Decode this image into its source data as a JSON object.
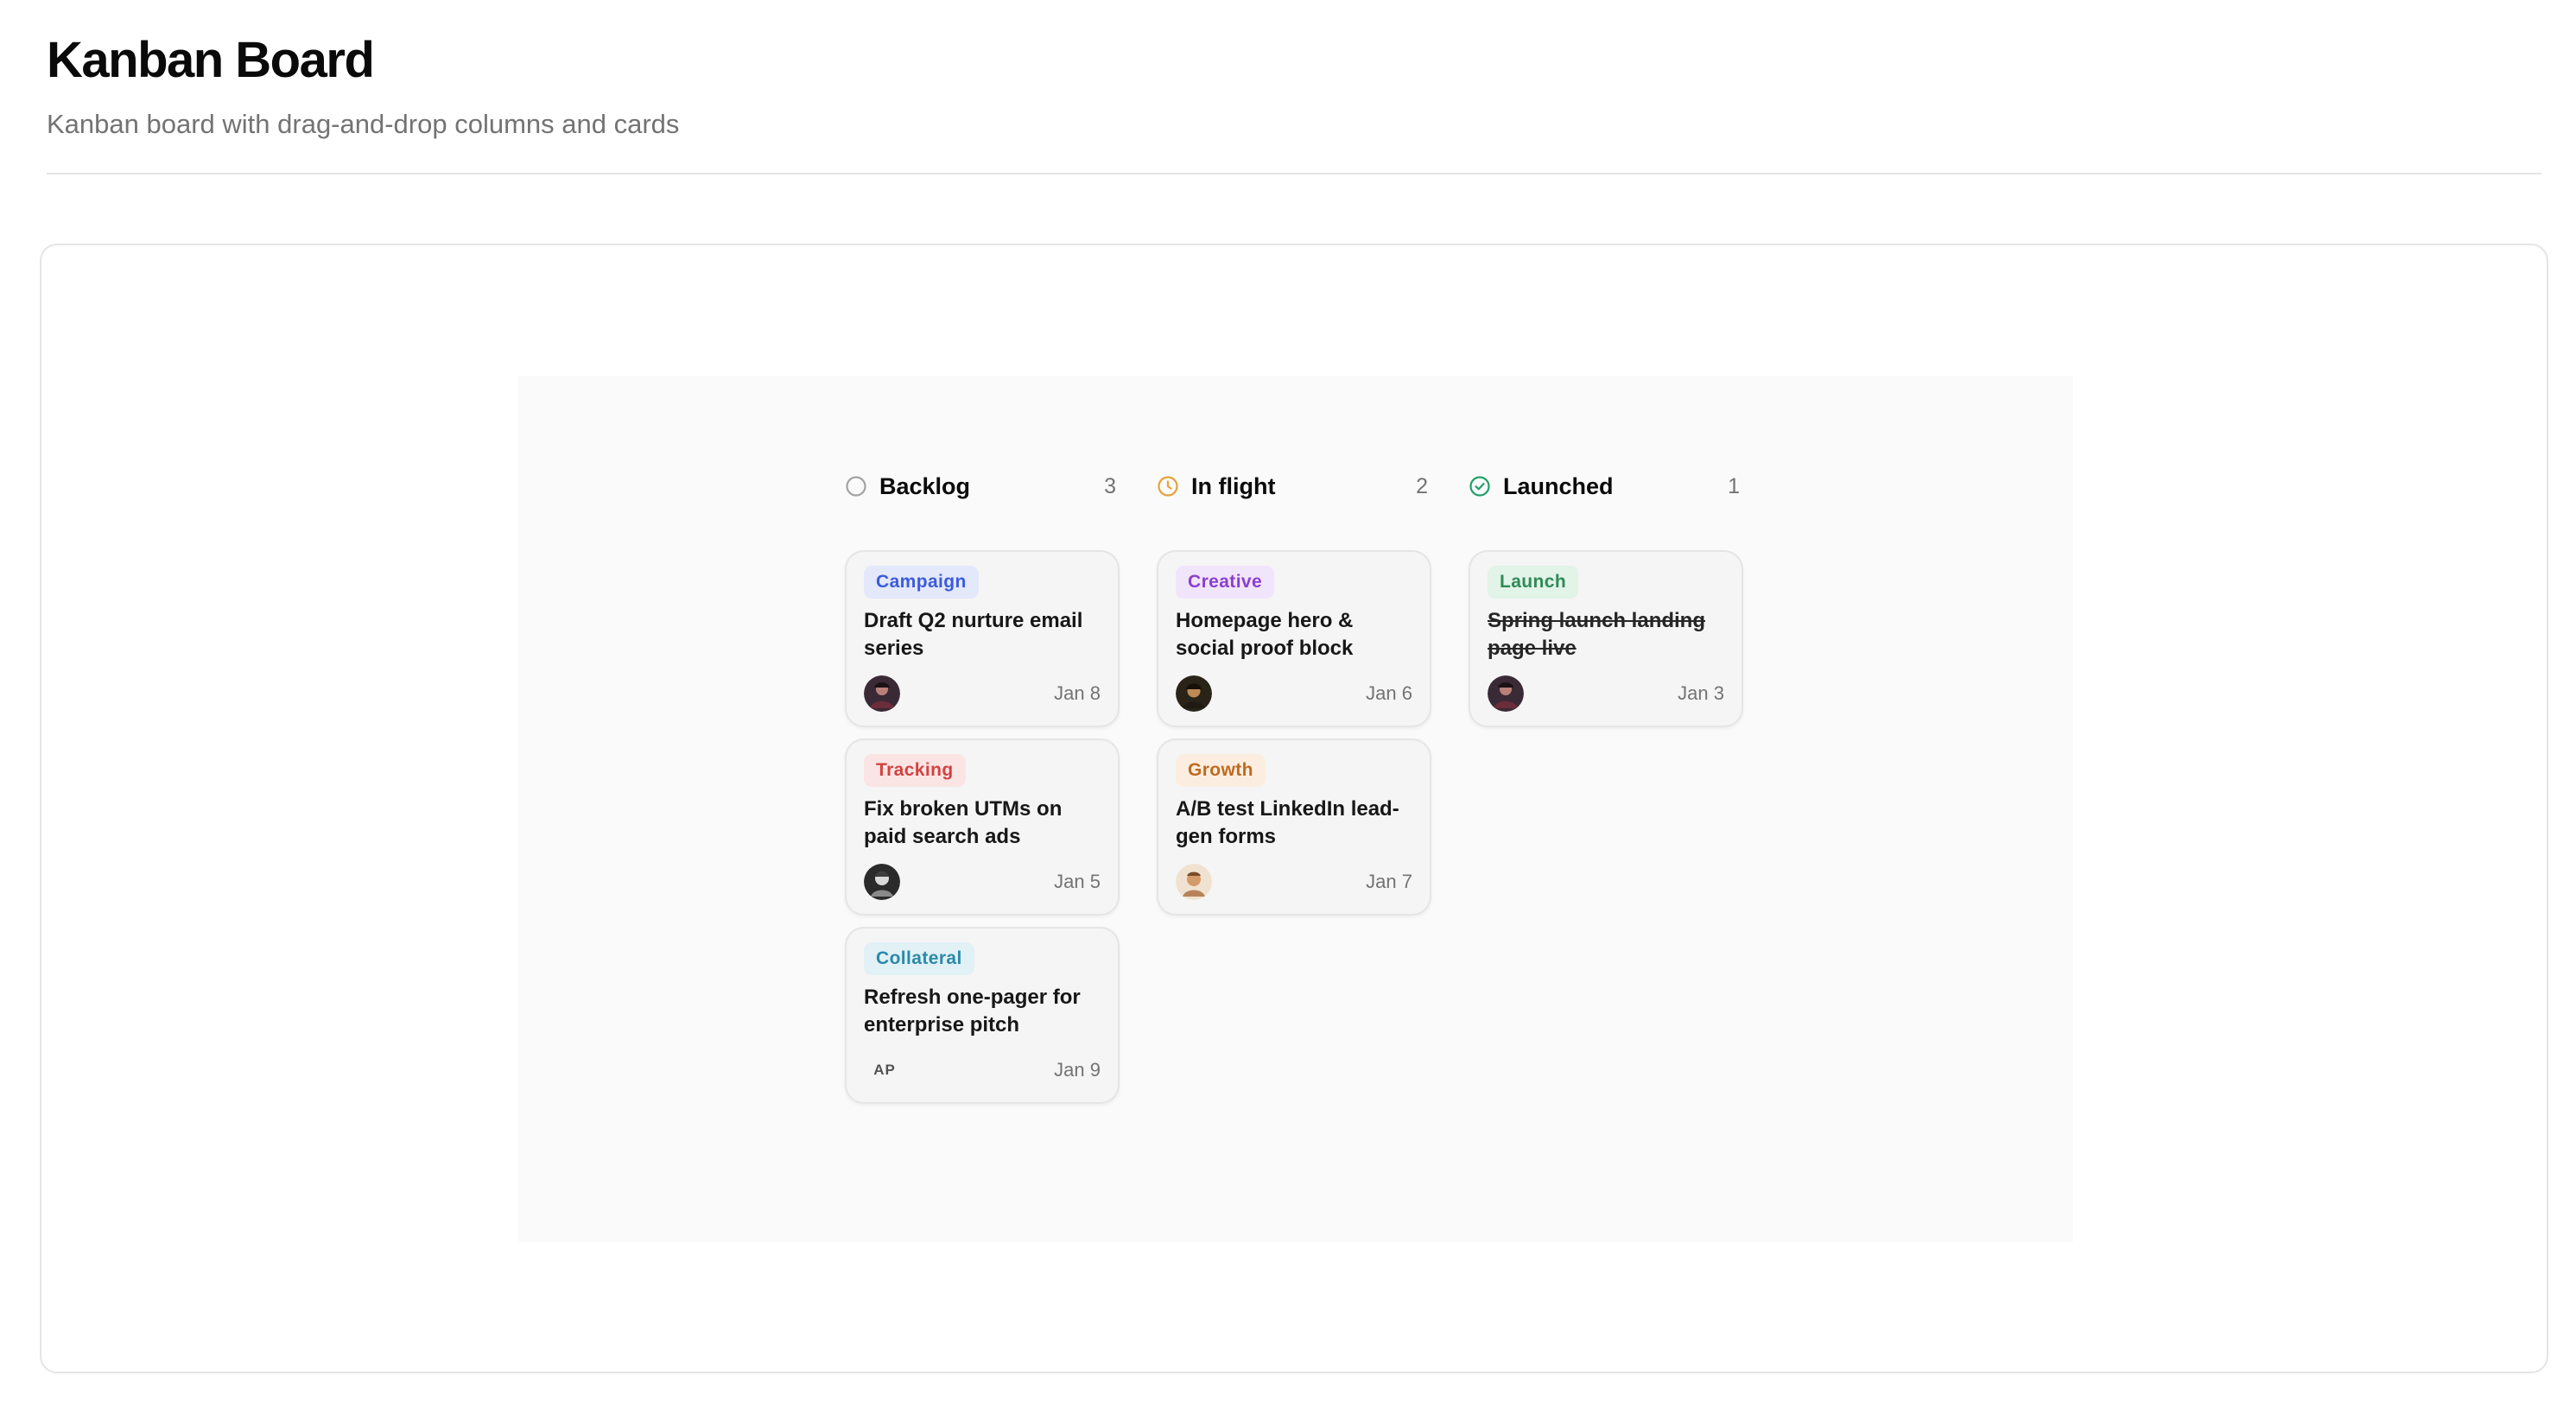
{
  "page": {
    "title": "Kanban Board",
    "subtitle": "Kanban board with drag-and-drop columns and cards"
  },
  "colors": {
    "backlog_icon": "#a3a3a3",
    "inflight_icon": "#e5a23a",
    "launched_icon": "#22a06b"
  },
  "columns": [
    {
      "title": "Backlog",
      "count": "3",
      "icon": "circle-outline-icon",
      "cards": [
        {
          "tag": "Campaign",
          "tag_color": "#3b5bdb",
          "tag_bg": "#e3e8fb",
          "title": "Draft Q2 nurture email series",
          "date": "Jan 8",
          "avatar": "avatar-photo"
        },
        {
          "tag": "Tracking",
          "tag_color": "#d14343",
          "tag_bg": "#fbe4e4",
          "title": "Fix broken UTMs on paid search ads",
          "date": "Jan 5",
          "avatar": "avatar-photo"
        },
        {
          "tag": "Collateral",
          "tag_color": "#2b8aa8",
          "tag_bg": "#e1f1f6",
          "title": "Refresh one-pager for enterprise pitch",
          "date": "Jan 9",
          "avatar_initials": "AP"
        }
      ]
    },
    {
      "title": "In flight",
      "count": "2",
      "icon": "clock-icon",
      "cards": [
        {
          "tag": "Creative",
          "tag_color": "#8b3fd1",
          "tag_bg": "#f1e5fb",
          "title": "Homepage hero & social proof block",
          "date": "Jan 6",
          "avatar": "avatar-photo"
        },
        {
          "tag": "Growth",
          "tag_color": "#c06a1f",
          "tag_bg": "#fbeee0",
          "title": "A/B test LinkedIn lead-gen forms",
          "date": "Jan 7",
          "avatar": "avatar-photo"
        }
      ]
    },
    {
      "title": "Launched",
      "count": "1",
      "icon": "check-circle-icon",
      "cards": [
        {
          "tag": "Launch",
          "tag_color": "#2f8a57",
          "tag_bg": "#e2f3e8",
          "title": "Spring launch landing page live",
          "date": "Jan 3",
          "avatar": "avatar-photo"
        }
      ]
    }
  ]
}
